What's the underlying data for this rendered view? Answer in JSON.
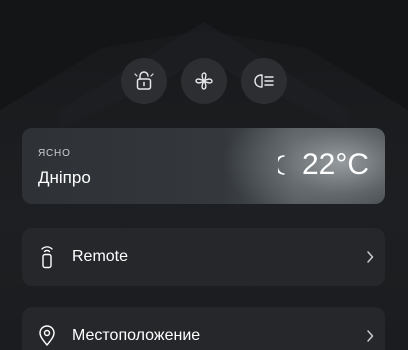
{
  "quick_actions": [
    {
      "icon": "unlock-icon"
    },
    {
      "icon": "fan-icon"
    },
    {
      "icon": "headlight-icon"
    }
  ],
  "weather": {
    "condition": "ЯСНО",
    "city": "Дніпро",
    "temperature": "22°C",
    "icon": "moon-icon"
  },
  "menu": {
    "remote": {
      "label": "Remote",
      "icon": "remote-icon"
    },
    "location": {
      "label": "Местоположение",
      "icon": "location-pin-icon"
    }
  },
  "colors": {
    "background": "#1a1b1d",
    "card": "#25272b",
    "button": "#2c2e32"
  }
}
